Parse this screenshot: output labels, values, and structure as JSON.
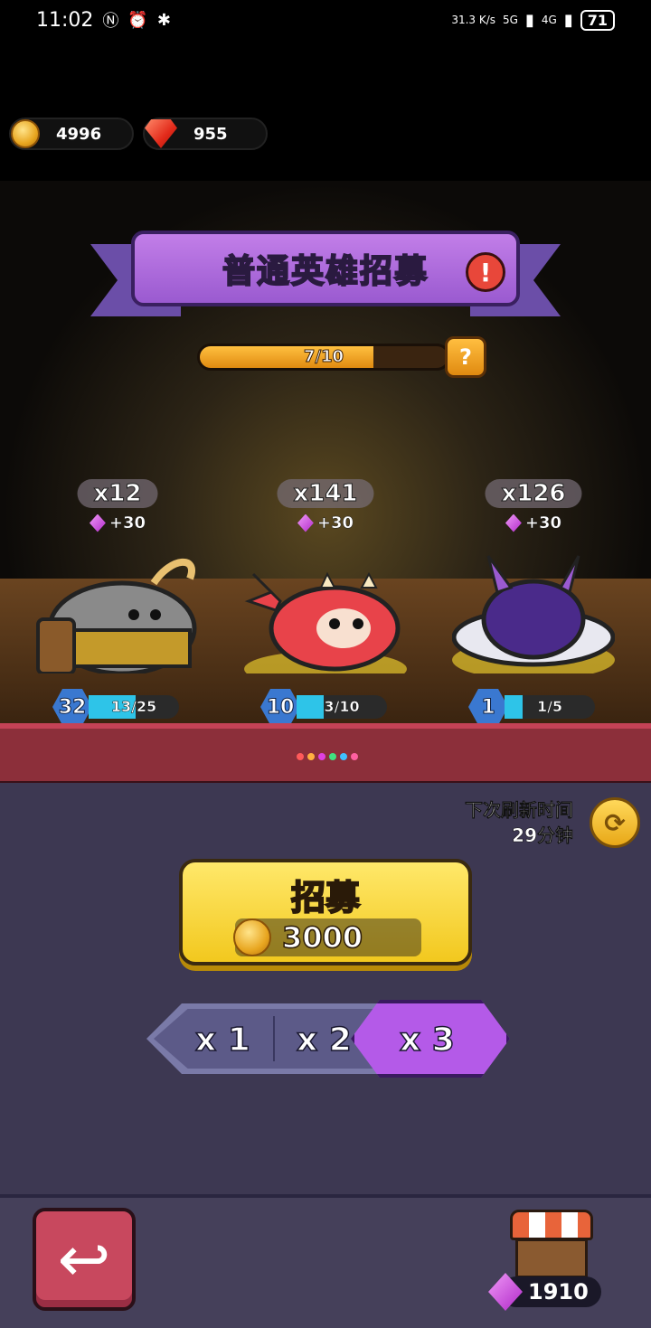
{
  "status_bar": {
    "time": "11:02",
    "net_speed": "31.3 K/s",
    "signal_1": "5G",
    "signal_2": "4G",
    "battery": "71"
  },
  "currency": {
    "coins": "4996",
    "rubies": "955"
  },
  "banner": {
    "title": "普通英雄招募",
    "alert_icon": "!"
  },
  "progress": {
    "text": "7/10",
    "fraction": 0.7,
    "help_icon": "?"
  },
  "heroes": [
    {
      "count": "x12",
      "bonus": "+30",
      "level": "32",
      "xp": "13/25",
      "xp_fraction": 0.52,
      "color": "#8a8a8a"
    },
    {
      "count": "x141",
      "bonus": "+30",
      "level": "10",
      "xp": "3/10",
      "xp_fraction": 0.3,
      "color": "#e8434a"
    },
    {
      "count": "x126",
      "bonus": "+30",
      "level": "1",
      "xp": "1/5",
      "xp_fraction": 0.2,
      "color": "#4a2a8a"
    }
  ],
  "refresh": {
    "label": "下次刷新时间",
    "time": "29分钟"
  },
  "recruit": {
    "label": "招募",
    "cost": "3000"
  },
  "multipliers": {
    "options": [
      "x 1",
      "x 2",
      "x 3"
    ],
    "selected": "x 3"
  },
  "shop": {
    "gems": "1910"
  },
  "colors": {
    "accent_purple": "#b45ae8",
    "recruit_yellow": "#f2c81e",
    "back_red": "#c8485e"
  }
}
